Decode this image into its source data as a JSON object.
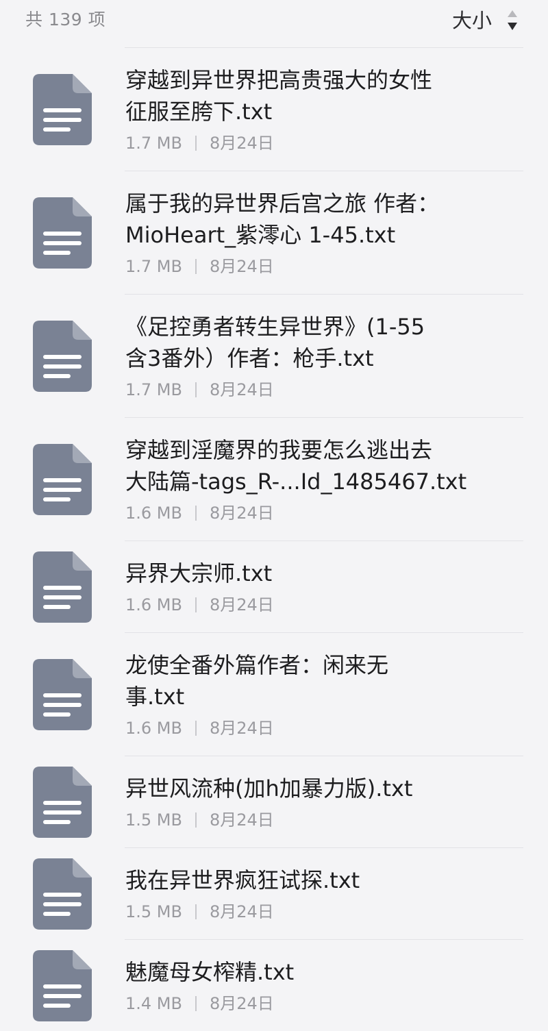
{
  "header": {
    "count_label": "共 139 项",
    "sort_label": "大小"
  },
  "colors": {
    "background": "#f4f4f6",
    "file_icon": "#7a8294",
    "divider": "#e2e2e6"
  },
  "icons": {
    "file": "text-file-icon",
    "sort": "sort-up-down-icon"
  },
  "files": [
    {
      "name": "穿越到异世界把高贵强大的女性\n征服至胯下.txt",
      "size": "1.7 MB",
      "date": "8月24日"
    },
    {
      "name": "属于我的异世界后宫之旅 作者：\nMioHeart_紫澪心 1-45.txt",
      "size": "1.7 MB",
      "date": "8月24日"
    },
    {
      "name": "《足控勇者转生异世界》(1-55\n含3番外）作者：枪手.txt",
      "size": "1.7 MB",
      "date": "8月24日"
    },
    {
      "name": "穿越到淫魔界的我要怎么逃出去\n大陆篇-tags_R-...Id_1485467.txt",
      "size": "1.6 MB",
      "date": "8月24日"
    },
    {
      "name": "异界大宗师.txt",
      "size": "1.6 MB",
      "date": "8月24日"
    },
    {
      "name": "龙使全番外篇作者：闲来无\n事.txt",
      "size": "1.6 MB",
      "date": "8月24日"
    },
    {
      "name": "异世风流种(加h加暴力版).txt",
      "size": "1.5 MB",
      "date": "8月24日"
    },
    {
      "name": "我在异世界疯狂试探.txt",
      "size": "1.5 MB",
      "date": "8月24日"
    },
    {
      "name": "魅魔母女榨精.txt",
      "size": "1.4 MB",
      "date": "8月24日"
    }
  ]
}
